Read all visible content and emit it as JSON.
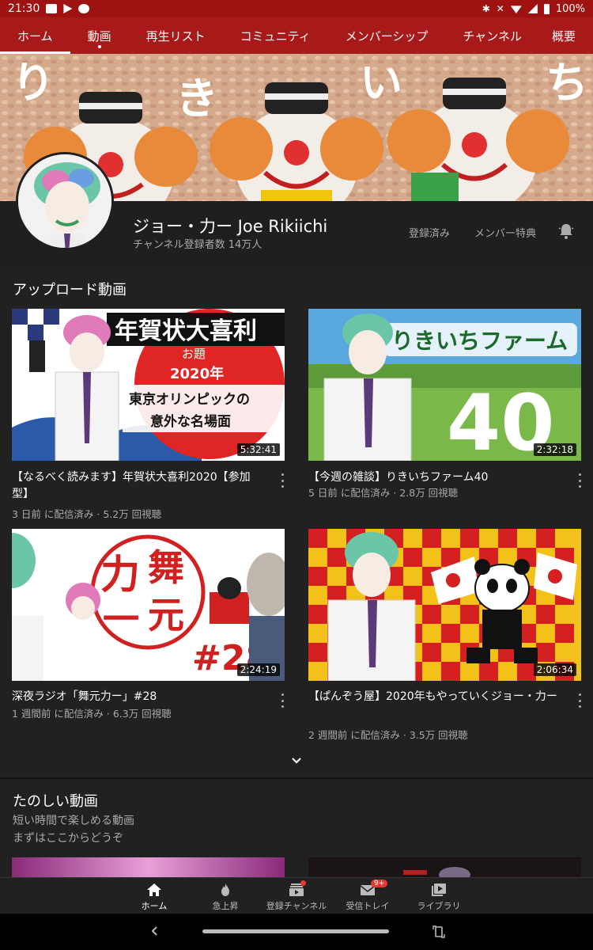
{
  "status": {
    "time": "21:30",
    "battery": "100%"
  },
  "tabs": [
    {
      "label": "ホーム"
    },
    {
      "label": "動画"
    },
    {
      "label": "再生リスト"
    },
    {
      "label": "コミュニティ"
    },
    {
      "label": "メンバーシップ"
    },
    {
      "label": "チャンネル"
    },
    {
      "label": "概要"
    }
  ],
  "banner": {
    "text": [
      "り",
      "き",
      "い",
      "ち"
    ]
  },
  "channel": {
    "name": "ジョー・力ー Joe Rikiichi",
    "subscribers": "チャンネル登録者数 14万人",
    "subscribed_label": "登録済み",
    "member_perks_label": "メンバー特典"
  },
  "uploads": {
    "title": "アップロード動画",
    "videos": [
      {
        "title": "【なるべく読みます】年賀状大喜利2020【参加型】",
        "meta": "3 日前 に配信済み · 5.2万 回視聴",
        "duration": "5:32:41",
        "thumb_text": [
          "年賀状大喜利",
          "お題",
          "2020年",
          "東京オリンピックの",
          "意外な名場面"
        ]
      },
      {
        "title": "【今週の雑談】りきいちファーム40",
        "meta": "5 日前 に配信済み · 2.8万 回視聴",
        "duration": "2:32:18",
        "thumb_text": [
          "りきいちファーム",
          "40"
        ]
      },
      {
        "title": "深夜ラジオ「舞元力ー」#28",
        "meta": "1 週間前 に配信済み · 6.3万 回視聴",
        "duration": "2:24:19",
        "thumb_text": [
          "力",
          "舞",
          "一",
          "元",
          "#28"
        ]
      },
      {
        "title": "【ぱんぞう屋】2020年もやっていくジョー・力ー",
        "meta": "2 週間前 に配信済み · 3.5万 回視聴",
        "duration": "2:06:34",
        "thumb_text": []
      }
    ]
  },
  "fun": {
    "title": "たのしい動画",
    "subtitle_1": "短い時間で楽しめる動画",
    "subtitle_2": "まずはここからどうぞ"
  },
  "bottom_nav": [
    {
      "label": "ホーム"
    },
    {
      "label": "急上昇"
    },
    {
      "label": "登録チャンネル"
    },
    {
      "label": "受信トレイ",
      "badge": "9+"
    },
    {
      "label": "ライブラリ"
    }
  ],
  "colors": {
    "brand_red": "#a81a1a",
    "status_red": "#9e1212",
    "bg": "#212121"
  }
}
